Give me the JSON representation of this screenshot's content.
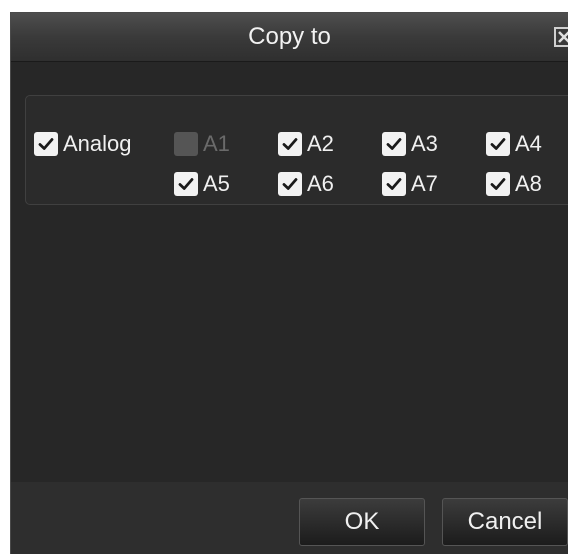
{
  "dialog": {
    "title": "Copy to",
    "close_icon": "close-icon"
  },
  "analog": {
    "label": "Analog",
    "checked": true
  },
  "channels": [
    {
      "label": "A1",
      "checked": false,
      "disabled": true
    },
    {
      "label": "A2",
      "checked": true,
      "disabled": false
    },
    {
      "label": "A3",
      "checked": true,
      "disabled": false
    },
    {
      "label": "A4",
      "checked": true,
      "disabled": false
    },
    {
      "label": "A5",
      "checked": true,
      "disabled": false
    },
    {
      "label": "A6",
      "checked": true,
      "disabled": false
    },
    {
      "label": "A7",
      "checked": true,
      "disabled": false
    },
    {
      "label": "A8",
      "checked": true,
      "disabled": false
    }
  ],
  "buttons": {
    "ok": "OK",
    "cancel": "Cancel"
  },
  "colors": {
    "dialog_bg": "#272727",
    "checkbox_fill": "#f2f2f2",
    "checkmark": "#1a1a1a",
    "disabled_text": "#6a6a6a"
  }
}
